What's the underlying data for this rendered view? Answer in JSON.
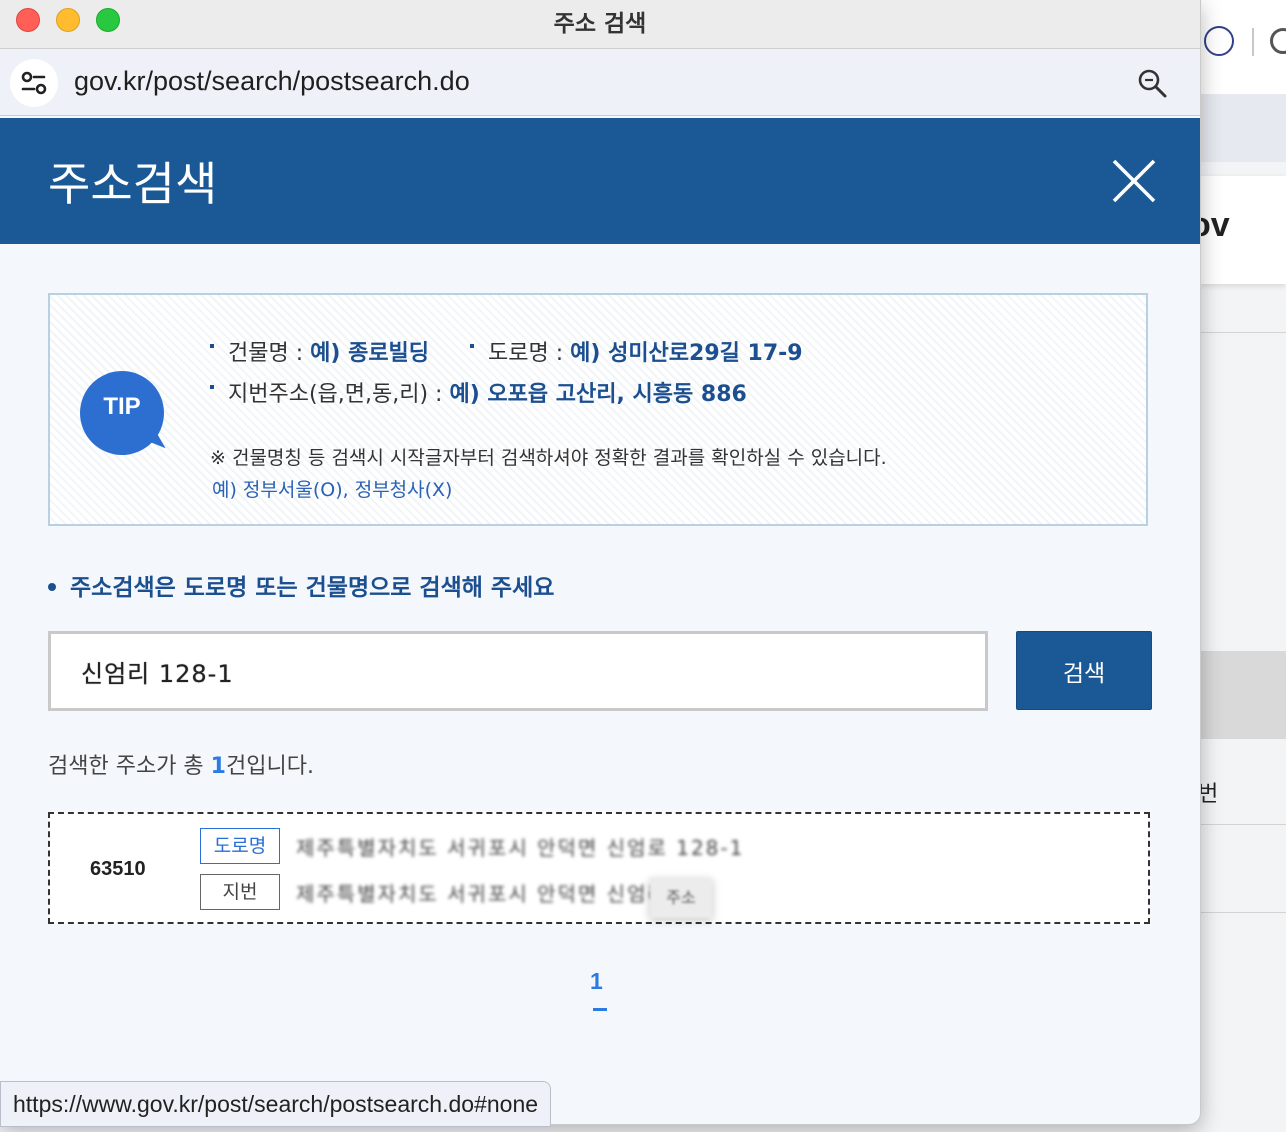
{
  "window": {
    "title": "주소 검색"
  },
  "browser": {
    "url": "gov.kr/post/search/postsearch.do",
    "status_url": "https://www.gov.kr/post/search/postsearch.do#none"
  },
  "background": {
    "gov_text": "ov",
    "beon_text": "번"
  },
  "header": {
    "title": "주소검색"
  },
  "tip": {
    "badge": "TIP",
    "building_label": "건물명 : ",
    "building_example": "예) 종로빌딩",
    "road_label": "도로명 : ",
    "road_example": "예) 성미산로29길 17-9",
    "jibun_label": "지번주소(읍,면,동,리) : ",
    "jibun_example": "예) 오포읍 고산리, 시흥동 886",
    "note": "※ 건물명칭 등 검색시 시작글자부터 검색하셔야 정확한 결과를 확인하실 수 있습니다.",
    "note_example": "예) 정부서울(O), 정부청사(X)"
  },
  "guide": {
    "text": "주소검색은 도로명 또는 건물명으로 검색해 주세요"
  },
  "search": {
    "value": "신엄리 128-1",
    "button": "검색"
  },
  "result_count": {
    "prefix": "검색한 주소가 총 ",
    "count": "1",
    "suffix": "건입니다."
  },
  "results": [
    {
      "zipcode": "63510",
      "road_tag": "도로명",
      "road_address": "제주특별자치도 서귀포시 안덕면 신엄로 128-1",
      "jibun_tag": "지번",
      "jibun_address": "제주특별자치도 서귀포시 안덕면 신엄리",
      "hover_chip": "주소"
    }
  ],
  "pagination": {
    "current": "1"
  },
  "colors": {
    "header": "#1b5996",
    "accent": "#2a7be4",
    "tip_badge": "#2d6fd0"
  }
}
